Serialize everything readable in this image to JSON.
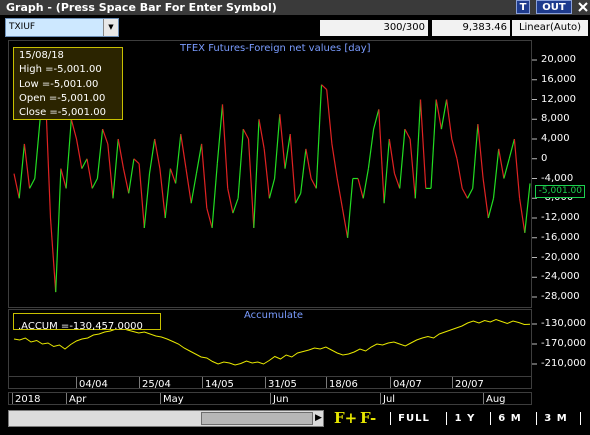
{
  "window": {
    "title": "Graph  - (Press Space Bar For Enter Symbol)",
    "buttons": {
      "t": "T",
      "out": "OUT",
      "close": "X"
    }
  },
  "toolbar": {
    "symbol": "TXIUF",
    "count": "300/300",
    "price": "9,383.46",
    "scale": "Linear(Auto)"
  },
  "info": {
    "date": "15/08/18",
    "high": "High  =-5,001.00",
    "low": "Low  =-5,001.00",
    "open": "Open  =-5,001.00",
    "close": "Close  =-5,001.00"
  },
  "panel_titles": {
    "main": "TFEX Futures-Foreign net values [day]",
    "accum": "Accumulate"
  },
  "accum_readout": ".ACCUM   =-130,457.0000",
  "last_value": "-5,001.00",
  "y_ticks_main": [
    "20,000",
    "16,000",
    "12,000",
    "8,000",
    "4,000",
    "0",
    "-4,000",
    "-8,000",
    "-12,000",
    "-16,000",
    "-20,000",
    "-24,000",
    "-28,000"
  ],
  "y_ticks_accum": [
    "-130,000",
    "-170,000",
    "-210,000"
  ],
  "date_row1": [
    "04/04",
    "25/04",
    "14/05",
    "31/05",
    "18/06",
    "04/07",
    "20/07"
  ],
  "date_row2": [
    "2018",
    "Apr",
    "May",
    "Jun",
    "Jul",
    "Aug"
  ],
  "bottom": {
    "fplus": "F+",
    "fminus": "F-",
    "full": "FULL",
    "y1": "1 Y",
    "m6": "6 M",
    "m3": "3 M"
  },
  "colors": {
    "up": "#22dd22",
    "down": "#e02222",
    "accum_line": "#e8e800",
    "axis_label": "#7a9cff"
  },
  "chart_data": [
    {
      "type": "line",
      "title": "TFEX Futures-Foreign net values [day]",
      "ylim": [
        -28000,
        20000
      ],
      "x_labels": [
        "04/04",
        "25/04",
        "14/05",
        "31/05",
        "18/06",
        "04/07",
        "20/07"
      ],
      "series": [
        {
          "values": [
            -3000,
            -8000,
            3000,
            -6000,
            -4000,
            8000,
            14000,
            -12000,
            -27000,
            -2000,
            -6000,
            8000,
            4000,
            -2000,
            0,
            -6000,
            -4000,
            6000,
            3000,
            -8000,
            4000,
            -2000,
            -7000,
            0,
            -1000,
            -14000,
            -3000,
            4000,
            -2000,
            -12000,
            -2000,
            -5000,
            5000,
            -2000,
            -9000,
            -3000,
            3000,
            -10000,
            -14000,
            -1000,
            11000,
            -6000,
            -11000,
            -8000,
            6000,
            4000,
            -14000,
            8000,
            2000,
            -8000,
            -4000,
            9000,
            -2000,
            5000,
            -9000,
            -7000,
            2000,
            -4000,
            -6000,
            15000,
            14000,
            3000,
            -4000,
            -10000,
            -16000,
            -4000,
            -4000,
            -8000,
            -2000,
            6000,
            10000,
            -9000,
            4000,
            -3000,
            -6000,
            6000,
            4000,
            -8000,
            12000,
            -6000,
            -6000,
            12000,
            6000,
            12000,
            4000,
            0,
            -6000,
            -8000,
            -6000,
            7000,
            -4000,
            -12000,
            -8000,
            2000,
            -4000,
            0,
            4000,
            -8000,
            -15000,
            -5001
          ]
        }
      ]
    },
    {
      "type": "line",
      "title": "Accumulate",
      "ylim": [
        -230000,
        -110000
      ],
      "series": [
        {
          "values": [
            -160000,
            -162000,
            -158000,
            -166000,
            -163000,
            -170000,
            -168000,
            -175000,
            -172000,
            -180000,
            -171000,
            -164000,
            -160000,
            -158000,
            -152000,
            -150000,
            -146000,
            -144000,
            -140000,
            -138000,
            -142000,
            -145000,
            -148000,
            -146000,
            -150000,
            -154000,
            -156000,
            -160000,
            -165000,
            -170000,
            -178000,
            -184000,
            -190000,
            -196000,
            -198000,
            -205000,
            -210000,
            -206000,
            -208000,
            -212000,
            -209000,
            -204000,
            -208000,
            -206000,
            -210000,
            -203000,
            -195000,
            -200000,
            -192000,
            -196000,
            -188000,
            -185000,
            -182000,
            -178000,
            -180000,
            -176000,
            -182000,
            -188000,
            -192000,
            -190000,
            -186000,
            -180000,
            -184000,
            -176000,
            -170000,
            -172000,
            -168000,
            -166000,
            -170000,
            -174000,
            -168000,
            -162000,
            -158000,
            -155000,
            -158000,
            -150000,
            -146000,
            -142000,
            -138000,
            -134000,
            -128000,
            -124000,
            -128000,
            -123000,
            -126000,
            -121000,
            -125000,
            -129000,
            -124000,
            -127000,
            -131000,
            -130457
          ]
        }
      ]
    }
  ]
}
